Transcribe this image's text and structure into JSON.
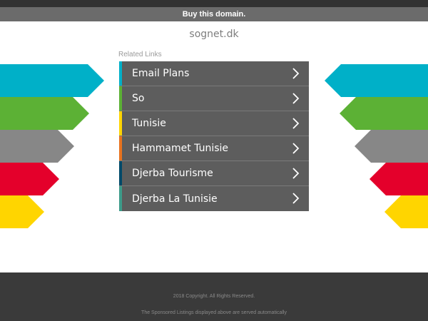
{
  "buy_bar": {
    "label": "Buy this domain."
  },
  "domain": "sognet.dk",
  "related": {
    "title": "Related Links",
    "items": [
      {
        "label": "Email Plans",
        "stripe": "#00b0c8"
      },
      {
        "label": "So",
        "stripe": "#5cb135"
      },
      {
        "label": "Tunisie",
        "stripe": "#ffd500"
      },
      {
        "label": "Hammamet Tunisie",
        "stripe": "#e8731f"
      },
      {
        "label": "Djerba Tourisme",
        "stripe": "#004a6a"
      },
      {
        "label": "Djerba La Tunisie",
        "stripe": "#3d9b8a"
      }
    ]
  },
  "decor_colors": [
    "#00b0c8",
    "#5cb135",
    "#878787",
    "#e4002b",
    "#ffd500"
  ],
  "footer": {
    "copyright": "2018 Copyright. All Rights Reserved.",
    "disclaimer": "The Sponsored Listings displayed above are served automatically"
  }
}
